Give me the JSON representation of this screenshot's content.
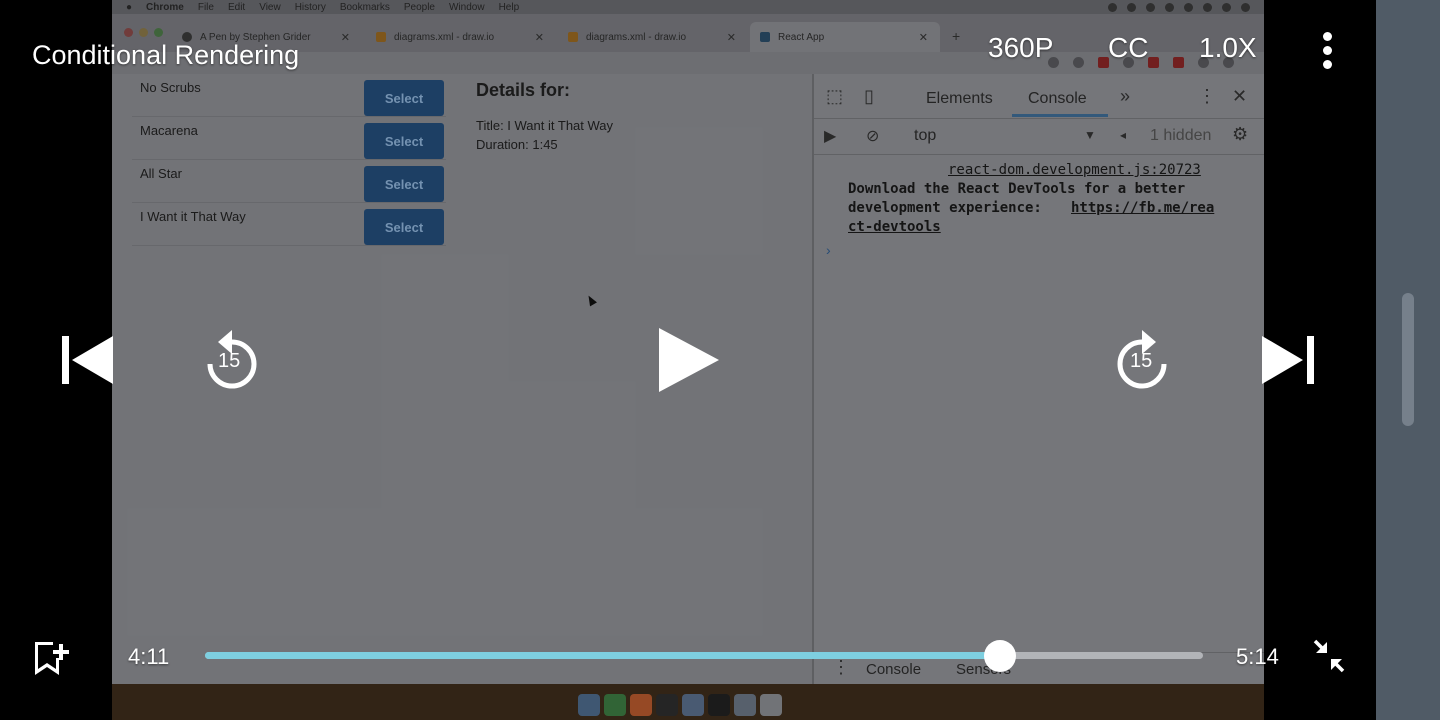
{
  "player": {
    "title": "Conditional Rendering",
    "quality": "360P",
    "captions": "CC",
    "speed": "1.0X",
    "rewind_seconds": "15",
    "forward_seconds": "15",
    "current_time": "4:11",
    "total_time": "5:14",
    "progress_fraction": 0.797,
    "accent_color": "#7ecfe0",
    "icons": [
      "more-vert-icon",
      "skip-previous-icon",
      "replay-15-icon",
      "play-icon",
      "forward-15-icon",
      "skip-next-icon",
      "bookmark-add-icon",
      "minimize-icon"
    ]
  },
  "video_frame": {
    "menubar": {
      "app": "Chrome",
      "items": [
        "File",
        "Edit",
        "View",
        "History",
        "Bookmarks",
        "People",
        "Window",
        "Help"
      ]
    },
    "tabs": [
      {
        "label": "A Pen by Stephen Grider"
      },
      {
        "label": "diagrams.xml - draw.io"
      },
      {
        "label": "diagrams.xml - draw.io"
      },
      {
        "label": "React App"
      }
    ],
    "songs": [
      {
        "title": "No Scrubs",
        "button": "Select"
      },
      {
        "title": "Macarena",
        "button": "Select"
      },
      {
        "title": "All Star",
        "button": "Select"
      },
      {
        "title": "I Want it That Way",
        "button": "Select"
      }
    ],
    "details": {
      "heading": "Details for:",
      "title_line": "Title: I Want it That Way",
      "duration_line": "Duration: 1:45"
    },
    "devtools": {
      "tabs": [
        "Elements",
        "Console"
      ],
      "context": "top",
      "hidden_count": "1 hidden",
      "source_link": "react-dom.development.js:20723",
      "message_lines": [
        "Download the React DevTools for a better",
        "development experience: "
      ],
      "message_link_1": "https://fb.me/rea",
      "message_link_2": "ct-devtools",
      "drawer_tabs": [
        "Console",
        "Sensors"
      ]
    }
  }
}
